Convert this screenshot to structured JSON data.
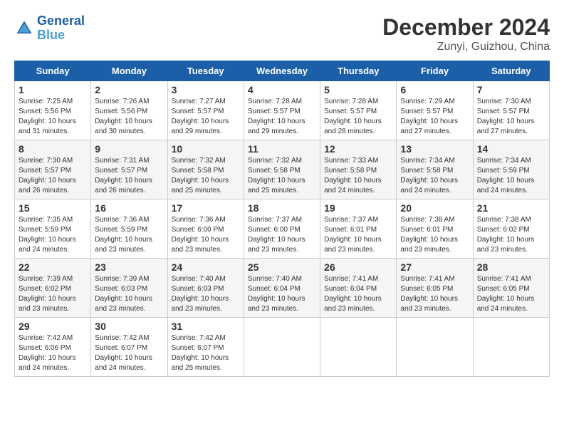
{
  "header": {
    "logo_line1": "General",
    "logo_line2": "Blue",
    "month": "December 2024",
    "location": "Zunyi, Guizhou, China"
  },
  "days_of_week": [
    "Sunday",
    "Monday",
    "Tuesday",
    "Wednesday",
    "Thursday",
    "Friday",
    "Saturday"
  ],
  "weeks": [
    [
      {
        "day": "1",
        "sunrise": "7:25 AM",
        "sunset": "5:56 PM",
        "daylight": "10 hours and 31 minutes."
      },
      {
        "day": "2",
        "sunrise": "7:26 AM",
        "sunset": "5:56 PM",
        "daylight": "10 hours and 30 minutes."
      },
      {
        "day": "3",
        "sunrise": "7:27 AM",
        "sunset": "5:57 PM",
        "daylight": "10 hours and 29 minutes."
      },
      {
        "day": "4",
        "sunrise": "7:28 AM",
        "sunset": "5:57 PM",
        "daylight": "10 hours and 29 minutes."
      },
      {
        "day": "5",
        "sunrise": "7:28 AM",
        "sunset": "5:57 PM",
        "daylight": "10 hours and 28 minutes."
      },
      {
        "day": "6",
        "sunrise": "7:29 AM",
        "sunset": "5:57 PM",
        "daylight": "10 hours and 27 minutes."
      },
      {
        "day": "7",
        "sunrise": "7:30 AM",
        "sunset": "5:57 PM",
        "daylight": "10 hours and 27 minutes."
      }
    ],
    [
      {
        "day": "8",
        "sunrise": "7:30 AM",
        "sunset": "5:57 PM",
        "daylight": "10 hours and 26 minutes."
      },
      {
        "day": "9",
        "sunrise": "7:31 AM",
        "sunset": "5:57 PM",
        "daylight": "10 hours and 26 minutes."
      },
      {
        "day": "10",
        "sunrise": "7:32 AM",
        "sunset": "5:58 PM",
        "daylight": "10 hours and 25 minutes."
      },
      {
        "day": "11",
        "sunrise": "7:32 AM",
        "sunset": "5:58 PM",
        "daylight": "10 hours and 25 minutes."
      },
      {
        "day": "12",
        "sunrise": "7:33 AM",
        "sunset": "5:58 PM",
        "daylight": "10 hours and 24 minutes."
      },
      {
        "day": "13",
        "sunrise": "7:34 AM",
        "sunset": "5:58 PM",
        "daylight": "10 hours and 24 minutes."
      },
      {
        "day": "14",
        "sunrise": "7:34 AM",
        "sunset": "5:59 PM",
        "daylight": "10 hours and 24 minutes."
      }
    ],
    [
      {
        "day": "15",
        "sunrise": "7:35 AM",
        "sunset": "5:59 PM",
        "daylight": "10 hours and 24 minutes."
      },
      {
        "day": "16",
        "sunrise": "7:36 AM",
        "sunset": "5:59 PM",
        "daylight": "10 hours and 23 minutes."
      },
      {
        "day": "17",
        "sunrise": "7:36 AM",
        "sunset": "6:00 PM",
        "daylight": "10 hours and 23 minutes."
      },
      {
        "day": "18",
        "sunrise": "7:37 AM",
        "sunset": "6:00 PM",
        "daylight": "10 hours and 23 minutes."
      },
      {
        "day": "19",
        "sunrise": "7:37 AM",
        "sunset": "6:01 PM",
        "daylight": "10 hours and 23 minutes."
      },
      {
        "day": "20",
        "sunrise": "7:38 AM",
        "sunset": "6:01 PM",
        "daylight": "10 hours and 23 minutes."
      },
      {
        "day": "21",
        "sunrise": "7:38 AM",
        "sunset": "6:02 PM",
        "daylight": "10 hours and 23 minutes."
      }
    ],
    [
      {
        "day": "22",
        "sunrise": "7:39 AM",
        "sunset": "6:02 PM",
        "daylight": "10 hours and 23 minutes."
      },
      {
        "day": "23",
        "sunrise": "7:39 AM",
        "sunset": "6:03 PM",
        "daylight": "10 hours and 23 minutes."
      },
      {
        "day": "24",
        "sunrise": "7:40 AM",
        "sunset": "6:03 PM",
        "daylight": "10 hours and 23 minutes."
      },
      {
        "day": "25",
        "sunrise": "7:40 AM",
        "sunset": "6:04 PM",
        "daylight": "10 hours and 23 minutes."
      },
      {
        "day": "26",
        "sunrise": "7:41 AM",
        "sunset": "6:04 PM",
        "daylight": "10 hours and 23 minutes."
      },
      {
        "day": "27",
        "sunrise": "7:41 AM",
        "sunset": "6:05 PM",
        "daylight": "10 hours and 23 minutes."
      },
      {
        "day": "28",
        "sunrise": "7:41 AM",
        "sunset": "6:05 PM",
        "daylight": "10 hours and 24 minutes."
      }
    ],
    [
      {
        "day": "29",
        "sunrise": "7:42 AM",
        "sunset": "6:06 PM",
        "daylight": "10 hours and 24 minutes."
      },
      {
        "day": "30",
        "sunrise": "7:42 AM",
        "sunset": "6:07 PM",
        "daylight": "10 hours and 24 minutes."
      },
      {
        "day": "31",
        "sunrise": "7:42 AM",
        "sunset": "6:07 PM",
        "daylight": "10 hours and 25 minutes."
      },
      null,
      null,
      null,
      null
    ]
  ]
}
